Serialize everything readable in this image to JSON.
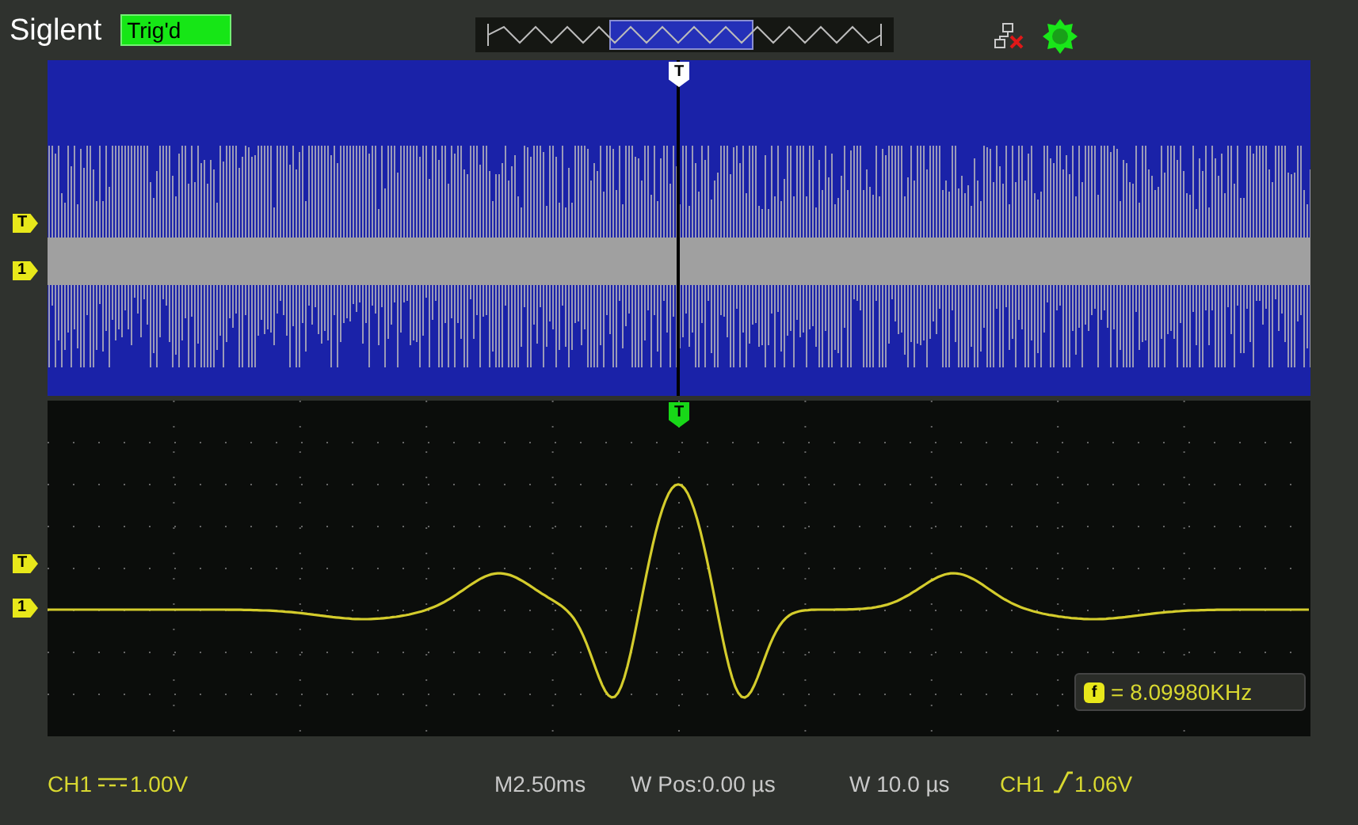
{
  "header": {
    "brand": "Siglent",
    "trigger_status": "Trig'd"
  },
  "zoom_window": {
    "trigger_marker": "T",
    "left_markers": [
      {
        "label": "T"
      },
      {
        "label": "1"
      }
    ]
  },
  "main_window": {
    "trigger_marker": "T",
    "left_markers": [
      {
        "label": "T"
      },
      {
        "label": "1"
      }
    ],
    "measurement": {
      "icon_label": "f",
      "value": "= 8.09980KHz"
    }
  },
  "status_bar": {
    "channel": {
      "name": "CH1",
      "scale": "1.00V"
    },
    "timebase": "M2.50ms",
    "window_position": "W Pos:0.00 µs",
    "window_scale": "W 10.0 µs",
    "trigger": {
      "source": "CH1",
      "level": "1.06V"
    }
  }
}
